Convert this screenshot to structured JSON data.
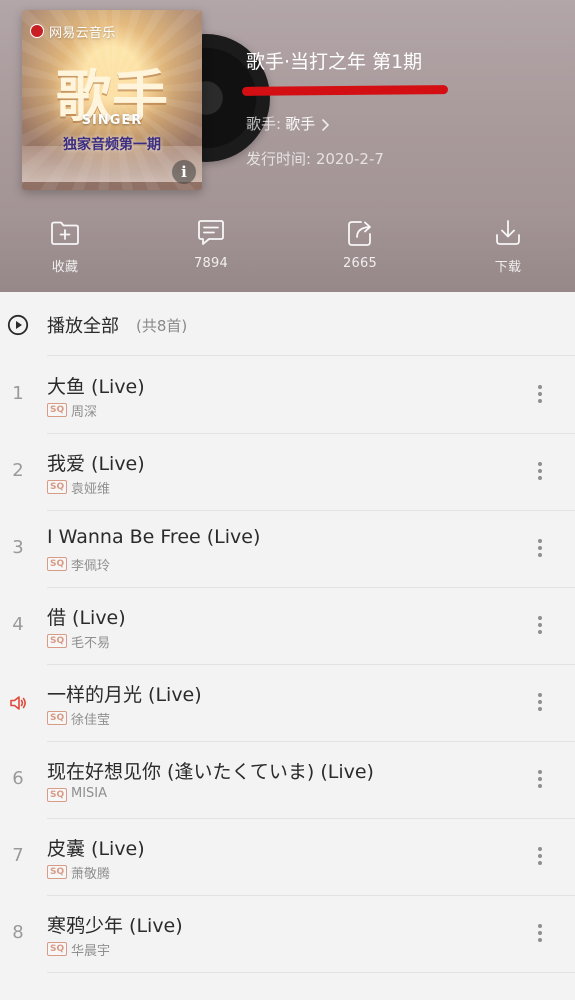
{
  "album": {
    "cover_brand": "网易云音乐",
    "cover_main": "歌手",
    "cover_singer": "SINGER",
    "cover_edition": "独家音频第一期",
    "title": "歌手·当打之年 第1期",
    "artist_label": "歌手:",
    "artist_name": "歌手",
    "release_label": "发行时间:",
    "release_date": "2020-2-7",
    "info_icon": "i"
  },
  "actions": {
    "collect_label": "收藏",
    "comments_count": "7894",
    "shares_count": "2665",
    "download_label": "下载"
  },
  "tracklist": {
    "play_all_label": "播放全部",
    "count_label": "(共8首)",
    "quality_badge": "SQ",
    "tracks": [
      {
        "index": "1",
        "title": "大鱼 (Live)",
        "artist": "周深",
        "playing": false
      },
      {
        "index": "2",
        "title": "我爱 (Live)",
        "artist": "袁娅维",
        "playing": false
      },
      {
        "index": "3",
        "title": "I Wanna Be Free (Live)",
        "artist": "李佩玲",
        "playing": false
      },
      {
        "index": "4",
        "title": "借 (Live)",
        "artist": "毛不易",
        "playing": false
      },
      {
        "index": "",
        "title": "一样的月光 (Live)",
        "artist": "徐佳莹",
        "playing": true
      },
      {
        "index": "6",
        "title": "现在好想见你 (逢いたくていま) (Live)",
        "artist": "MISIA",
        "playing": false
      },
      {
        "index": "7",
        "title": "皮囊 (Live)",
        "artist": "萧敬腾",
        "playing": false
      },
      {
        "index": "8",
        "title": "寒鸦少年 (Live)",
        "artist": "华晨宇",
        "playing": false
      }
    ]
  },
  "colors": {
    "accent_red": "#d40f14",
    "playing_icon": "#e04a3a",
    "sq_badge": "#d89b86"
  },
  "icons": {
    "collect": "folder-plus-icon",
    "comments": "comment-icon",
    "share": "share-icon",
    "download": "download-icon",
    "play_all": "play-circle-icon",
    "playing": "speaker-icon",
    "more": "more-vertical-icon"
  }
}
